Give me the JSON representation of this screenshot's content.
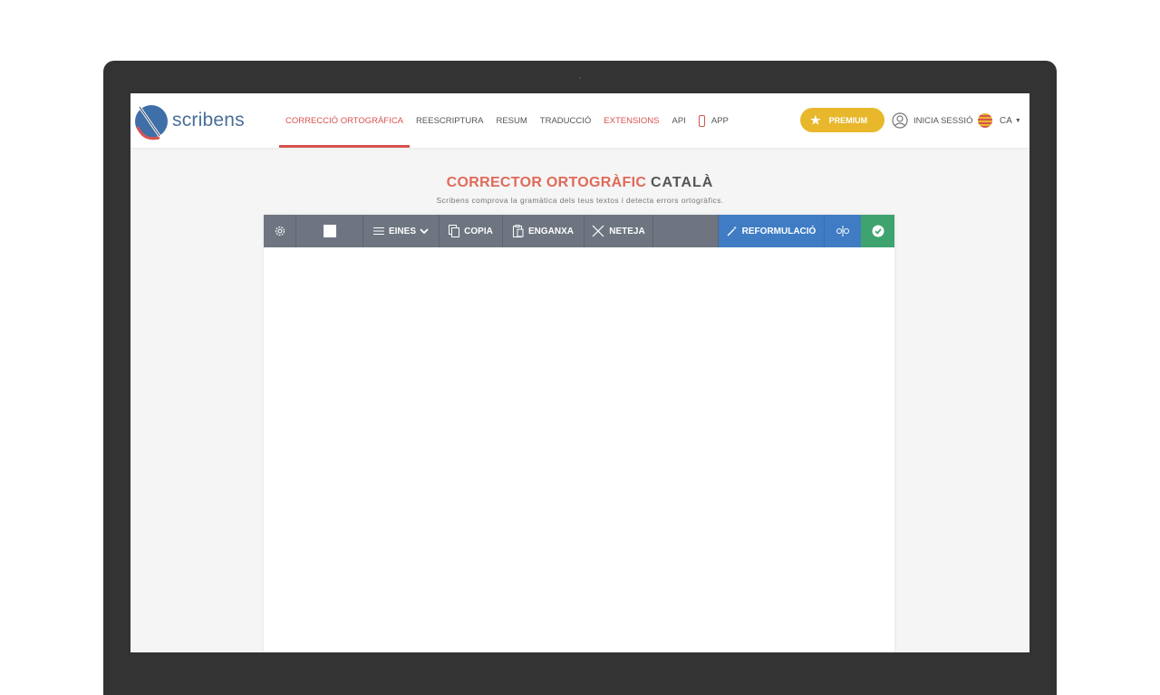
{
  "brand": {
    "name": "scribens"
  },
  "nav": {
    "items": [
      {
        "label": "CORRECCIÓ ORTOGRÀFICA"
      },
      {
        "label": "REESCRIPTURA"
      },
      {
        "label": "RESUM"
      },
      {
        "label": "TRADUCCIÓ"
      },
      {
        "label": "EXTENSIONS"
      },
      {
        "label": "API"
      },
      {
        "label": "APP"
      }
    ]
  },
  "header": {
    "premium_label": "PREMIUM",
    "login_label": "INICIA SESSIÓ",
    "lang_label": "CA"
  },
  "main": {
    "title_part1": "CORRECTOR ORTOGRÀFIC",
    "title_part2": "CATALÀ",
    "subtitle": "Scribens comprova la gramàtica dels teus textos i detecta errors ortogràfics."
  },
  "toolbar": {
    "eines_label": "EINES",
    "copia_label": "COPIA",
    "enganxa_label": "ENGANXA",
    "neteja_label": "NETEJA",
    "reformulacio_label": "REFORMULACIÓ"
  },
  "colors": {
    "accent_red": "#d9534f",
    "premium_yellow": "#e8b72c",
    "toolbar_gray": "#6e7580",
    "reform_blue": "#3f7cc4",
    "check_green": "#3ea36e"
  }
}
